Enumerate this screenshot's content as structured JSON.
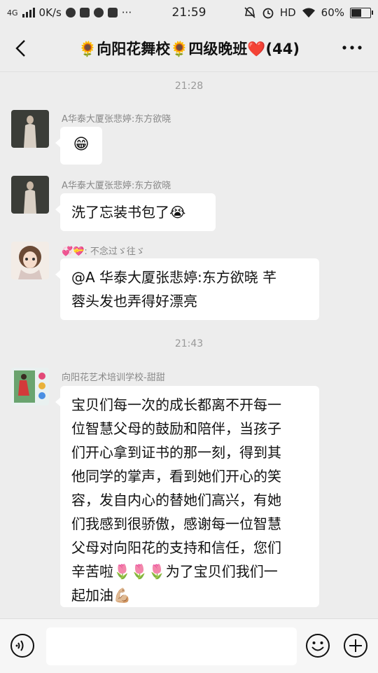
{
  "status_bar": {
    "network": "4G",
    "speed": "0K/s",
    "time": "21:59",
    "hd": "HD",
    "battery": "60%",
    "battery_level": 0.6
  },
  "header": {
    "title": "🌻向阳花舞校🌻四级晚班❤️(44)",
    "back_icon": "back-chevron-icon",
    "more_icon": "more-dots-icon"
  },
  "messages": {
    "time1": "21:28",
    "m1": {
      "sender": "A华泰大厦张悲婷:东方欲晓",
      "text": "😁"
    },
    "m2": {
      "sender": "A华泰大厦张悲婷:东方欲晓",
      "text": "洗了忘装书包了😭"
    },
    "m3": {
      "sender": "💞💝: 不念过ゞ往ゞ",
      "line1": "@A 华泰大厦张悲婷:东方欲晓  芊",
      "line2": "蓉头发也弄得好漂亮"
    },
    "time2": "21:43",
    "m4": {
      "sender": "向阳花艺术培训学校-甜甜",
      "lines": [
        "宝贝们每一次的成长都离不开每一",
        "位智慧父母的鼓励和陪伴，当孩子",
        "们开心拿到证书的那一刻，得到其",
        "他同学的掌声，看到她们开心的笑",
        "容，发自内心的替她们高兴，有她",
        "们我感到很骄傲，感谢每一位智慧",
        "父母对向阳花的支持和信任，您们",
        "辛苦啦🌷🌷🌷为了宝贝们我们一",
        "起加油💪🏼"
      ]
    }
  },
  "input_bar": {
    "voice_icon": "voice-icon",
    "emoji_icon": "emoji-icon",
    "plus_icon": "plus-icon",
    "placeholder": ""
  }
}
